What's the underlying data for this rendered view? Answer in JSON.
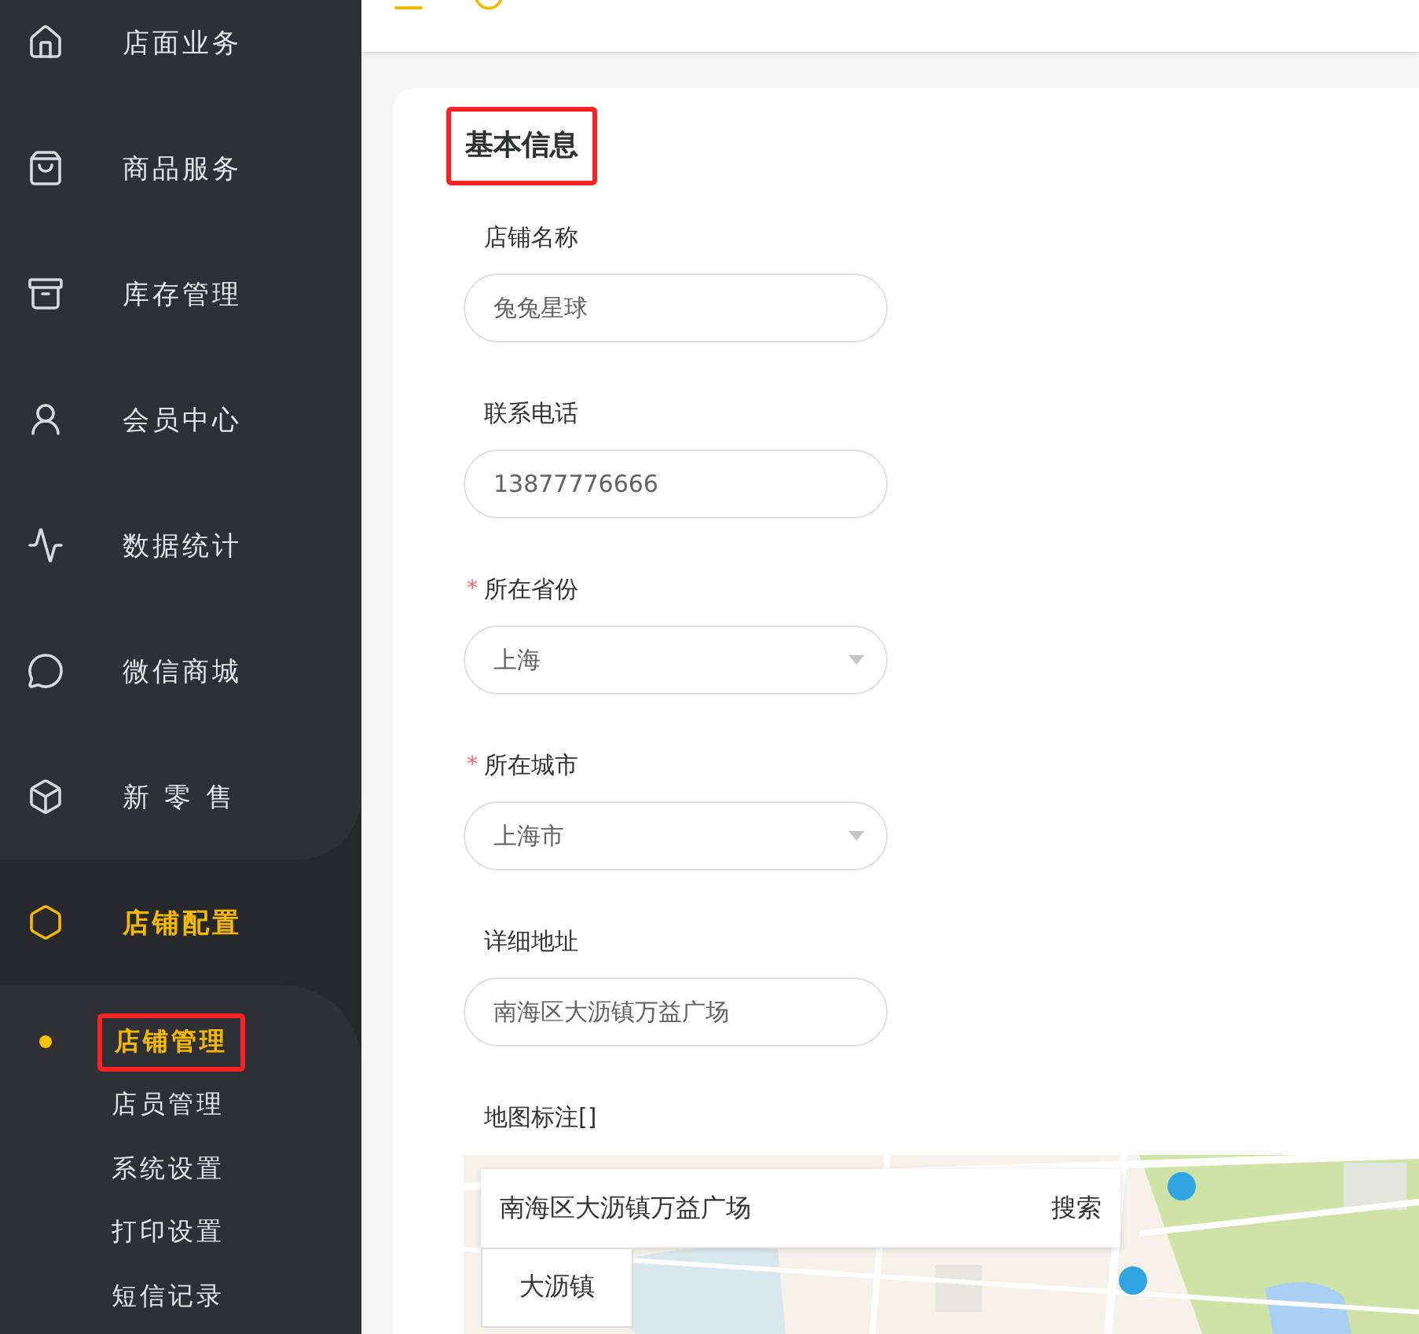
{
  "sidebar": {
    "items": [
      {
        "label": "店面业务",
        "selected": false
      },
      {
        "label": "商品服务",
        "selected": false
      },
      {
        "label": "库存管理",
        "selected": false
      },
      {
        "label": "会员中心",
        "selected": false
      },
      {
        "label": "数据统计",
        "selected": false
      },
      {
        "label": "微信商城",
        "selected": false
      },
      {
        "label": "新 零 售",
        "selected": false
      },
      {
        "label": "店铺配置",
        "selected": true,
        "children": [
          {
            "label": "店铺管理",
            "selected": true
          },
          {
            "label": "店员管理",
            "selected": false
          },
          {
            "label": "系统设置",
            "selected": false
          },
          {
            "label": "打印设置",
            "selected": false
          },
          {
            "label": "短信记录",
            "selected": false
          }
        ]
      }
    ]
  },
  "form": {
    "title": "基本信息",
    "required_mark": "*",
    "fields": [
      {
        "kind": "text",
        "label": "店铺名称",
        "required": false,
        "value": "兔兔星球"
      },
      {
        "kind": "text",
        "label": "联系电话",
        "required": false,
        "value": "13877776666"
      },
      {
        "kind": "select",
        "label": "所在省份",
        "required": true,
        "value": "上海"
      },
      {
        "kind": "select",
        "label": "所在城市",
        "required": true,
        "value": "上海市"
      },
      {
        "kind": "text",
        "label": "详细地址",
        "required": false,
        "value": "南海区大沥镇万益广场"
      }
    ],
    "map": {
      "label": "地图标注[]",
      "search_value": "南海区大沥镇万益广场",
      "search_button": "搜索",
      "suggestions": [
        "大沥镇"
      ]
    }
  }
}
